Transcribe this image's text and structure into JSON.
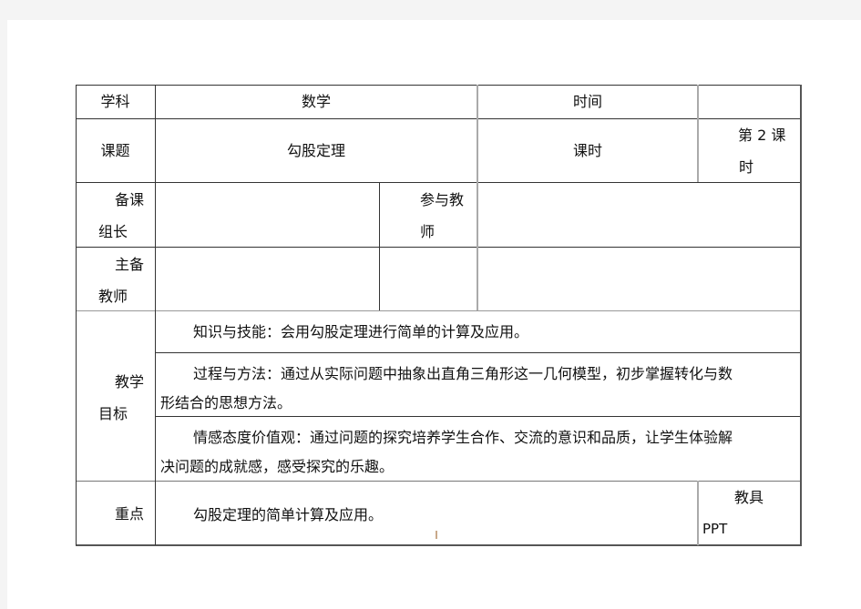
{
  "table": {
    "row1": {
      "subject_label": "学科",
      "subject_value": "数学",
      "time_label": "时间",
      "time_value": ""
    },
    "row2": {
      "topic_label": "课题",
      "topic_value": "勾股定理",
      "period_label": "课时",
      "period_value_line1": "第 2 课",
      "period_value_line2": "时"
    },
    "row3": {
      "leader_label_line1": "备课",
      "leader_label_line2": "组长",
      "leader_value": "",
      "participants_label_line1": "参与教",
      "participants_label_line2": "师",
      "participants_value": ""
    },
    "row4": {
      "main_teacher_label_line1": "主备",
      "main_teacher_label_line2": "教师",
      "main_teacher_value": ""
    },
    "objectives": {
      "label_line1": "教学",
      "label_line2": "目标",
      "items": [
        {
          "line1": "知识与技能：会用勾股定理进行简单的计算及应用。"
        },
        {
          "line1": "过程与方法：通过从实际问题中抽象出直角三角形这一几何模型，初步掌握转化与数",
          "line2": "形结合的思想方法。"
        },
        {
          "line1": "情感态度价值观：通过问题的探究培养学生合作、交流的意识和品质，让学生体验解",
          "line2": "决问题的成就感，感受探究的乐趣。"
        }
      ]
    },
    "key_point": {
      "label": "重点",
      "value": "勾股定理的简单计算及应用。",
      "tools_label": "教具",
      "tools_value": "PPT"
    }
  },
  "page_number": "1"
}
